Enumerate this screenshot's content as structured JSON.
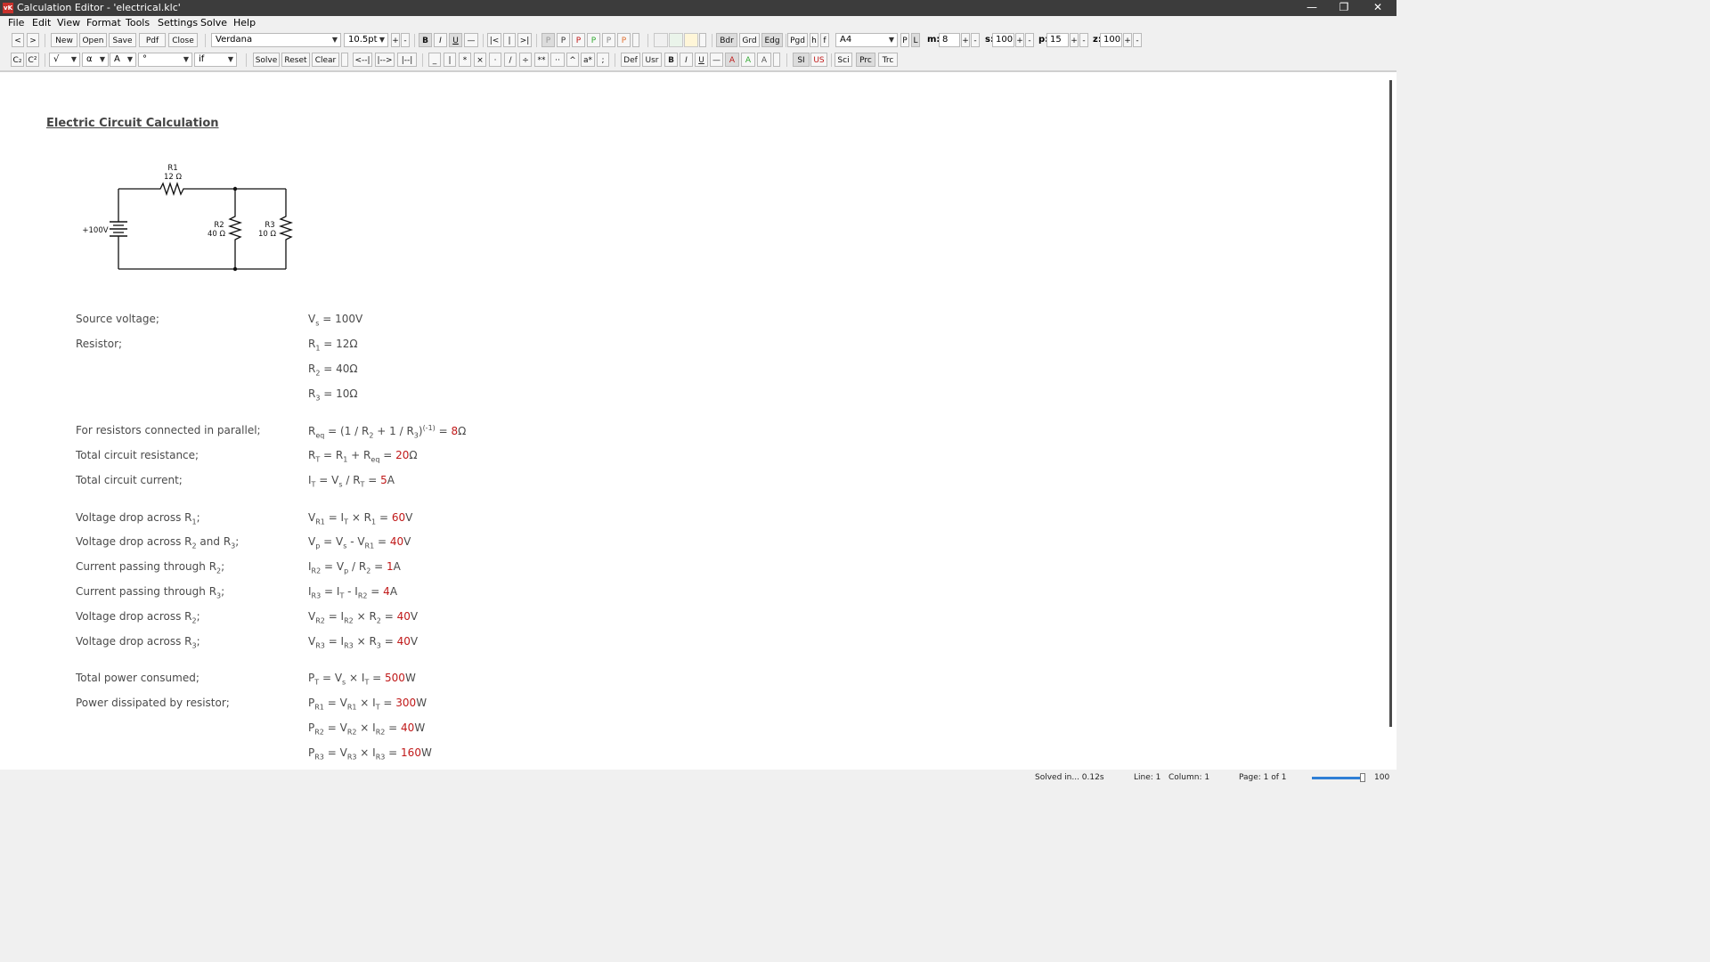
{
  "window": {
    "title": "Calculation Editor  -  'electrical.klc'",
    "icon_label": "vK",
    "minimize": "—",
    "maximize": "❐",
    "close": "✕"
  },
  "menu": [
    "File",
    "Edit",
    "View",
    "Format",
    "Tools",
    "Settings",
    "Solve",
    "Help"
  ],
  "toolbar1": {
    "back": "<",
    "forward": ">",
    "file_buttons": [
      "New",
      "Open",
      "Save",
      "Pdf",
      "Close"
    ],
    "font": "Verdana",
    "size": "10.5pt",
    "size_plus": "+",
    "size_minus": "-",
    "format_buttons": [
      "B",
      "I",
      "U",
      "—"
    ],
    "align_buttons": [
      "|<",
      "|",
      ">|"
    ],
    "paragraph_buttons": [
      "P",
      "P",
      "P",
      "P",
      "P",
      "P"
    ],
    "paragraph_colors": [
      "#999999",
      "#333333",
      "#c01818",
      "#33aa33",
      "#888888",
      "#e07030"
    ],
    "swatch_colors": [
      "#f0f0f0",
      "#eaf4ea",
      "#fff6d8"
    ],
    "view_buttons": [
      "Bdr",
      "Grd",
      "Edg"
    ],
    "page_buttons": [
      "Pgd",
      "h",
      "f"
    ],
    "paper": "A4",
    "orientation": [
      "P",
      "L"
    ],
    "m_label": "m:",
    "m_value": "8",
    "s_label": "s:",
    "s_value": "100",
    "p_label": "p:",
    "p_value": "15",
    "z_label": "z:",
    "z_value": "100",
    "plus": "+",
    "minus": "-"
  },
  "toolbar2": {
    "sub": "C₂",
    "sup": "C²",
    "sqrt": "√",
    "greek": "α",
    "alpha": "A",
    "degree": "°",
    "cond": "if",
    "solve_buttons": [
      "Solve",
      "Reset",
      "Clear"
    ],
    "indent_buttons": [
      "<--|",
      "|-->",
      "|--|"
    ],
    "op_buttons": [
      "_",
      "|",
      "*",
      "×",
      "·",
      "/",
      "÷",
      "**",
      "··",
      "^",
      "a*",
      ";"
    ],
    "def_buttons": [
      "Def",
      "Usr",
      "B",
      "I",
      "U",
      "—",
      "A",
      "A",
      "A"
    ],
    "def_colors": [
      "#222222",
      "#222222",
      "#222222",
      "#222222",
      "#222222",
      "#222222",
      "#c01818",
      "#33aa33",
      "#555555"
    ],
    "unit_buttons": [
      "SI",
      "US"
    ],
    "num_buttons": [
      "Sci",
      "Prc",
      "Trc"
    ]
  },
  "document": {
    "title": "Electric Circuit Calculation",
    "circuit": {
      "r1_name": "R1",
      "r1_value": "12 Ω",
      "r2_name": "R2",
      "r2_value": "40 Ω",
      "r3_name": "R3",
      "r3_value": "10 Ω",
      "source": "+100V"
    },
    "rows": [
      {
        "desc": "Source voltage;",
        "eq": "V<sub>s</sub> = 100V"
      },
      {
        "desc": "Resistor;",
        "eq": "R<sub>1</sub> = 12Ω"
      },
      {
        "desc": "",
        "eq": "R<sub>2</sub> = 40Ω"
      },
      {
        "desc": "",
        "eq": "R<sub>3</sub> = 10Ω"
      },
      {
        "desc": "For resistors connected in parallel;",
        "eq": "R<sub>eq</sub> = (1 / R<sub>2</sub> + 1 / R<sub>3</sub>)<sup>(-1)</sup> = <span class=\"res\">8</span>Ω"
      },
      {
        "desc": "Total circuit resistance;",
        "eq": "R<sub>T</sub> = R<sub>1</sub> + R<sub>eq</sub> = <span class=\"res\">20</span>Ω"
      },
      {
        "desc": "Total circuit current;",
        "eq": "I<sub>T</sub> = V<sub>s</sub> / R<sub>T</sub> = <span class=\"res\">5</span>A"
      },
      {
        "desc": "Voltage drop across R<sub>1</sub>;",
        "eq": "V<sub>R1</sub> = I<sub>T</sub> × R<sub>1</sub> = <span class=\"res\">60</span>V"
      },
      {
        "desc": "Voltage drop across R<sub>2</sub> and R<sub>3</sub>;",
        "eq": "V<sub>p</sub> = V<sub>s</sub> - V<sub>R1</sub> = <span class=\"res\">40</span>V"
      },
      {
        "desc": "Current passing through R<sub>2</sub>;",
        "eq": "I<sub>R2</sub> = V<sub>p</sub> / R<sub>2</sub> = <span class=\"res\">1</span>A"
      },
      {
        "desc": "Current passing through R<sub>3</sub>;",
        "eq": "I<sub>R3</sub> = I<sub>T</sub> - I<sub>R2</sub> = <span class=\"res\">4</span>A"
      },
      {
        "desc": "Voltage drop across R<sub>2</sub>;",
        "eq": "V<sub>R2</sub> = I<sub>R2</sub> × R<sub>2</sub> = <span class=\"res\">40</span>V"
      },
      {
        "desc": "Voltage drop across R<sub>3</sub>;",
        "eq": "V<sub>R3</sub> = I<sub>R3</sub> × R<sub>3</sub> = <span class=\"res\">40</span>V"
      },
      {
        "desc": "Total power consumed;",
        "eq": "P<sub>T</sub> = V<sub>s</sub> × I<sub>T</sub> = <span class=\"res\">500</span>W"
      },
      {
        "desc": "Power dissipated by resistor;",
        "eq": "P<sub>R1</sub> = V<sub>R1</sub> × I<sub>T</sub> = <span class=\"res\">300</span>W"
      },
      {
        "desc": "",
        "eq": "P<sub>R2</sub> = V<sub>R2</sub> × I<sub>R2</sub> = <span class=\"res\">40</span>W"
      },
      {
        "desc": "",
        "eq": "P<sub>R3</sub> = V<sub>R3</sub> × I<sub>R3</sub> = <span class=\"res\">160</span>W"
      }
    ]
  },
  "status": {
    "solved": "Solved in... 0.12s",
    "line": "Line: 1",
    "column": "Column: 1",
    "page": "Page: 1 of 1",
    "zoom": "100",
    "zoom_fraction": 0.95
  }
}
